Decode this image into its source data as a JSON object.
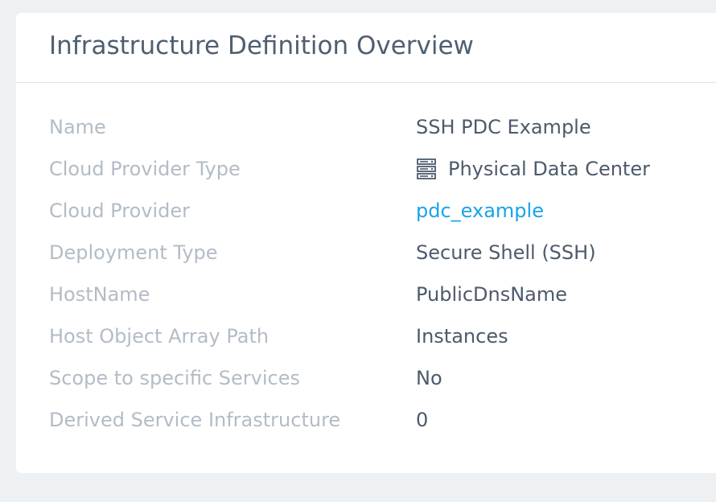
{
  "header": {
    "title": "Infrastructure Definition Overview"
  },
  "rows": [
    {
      "label": "Name",
      "value": "SSH PDC Example"
    },
    {
      "label": "Cloud Provider Type",
      "value": "Physical Data Center",
      "icon": "server-icon"
    },
    {
      "label": "Cloud Provider",
      "value": "pdc_example",
      "link": true
    },
    {
      "label": "Deployment Type",
      "value": "Secure Shell (SSH)"
    },
    {
      "label": "HostName",
      "value": "PublicDnsName"
    },
    {
      "label": "Host Object Array Path",
      "value": "Instances"
    },
    {
      "label": "Scope to specific Services",
      "value": "No"
    },
    {
      "label": "Derived Service Infrastructure",
      "value": "0"
    }
  ],
  "colors": {
    "background": "#eef1f4",
    "card": "#ffffff",
    "title": "#4f5e72",
    "label": "#b3bcc6",
    "value": "#4d5a6b",
    "link": "#1aa3e8"
  }
}
